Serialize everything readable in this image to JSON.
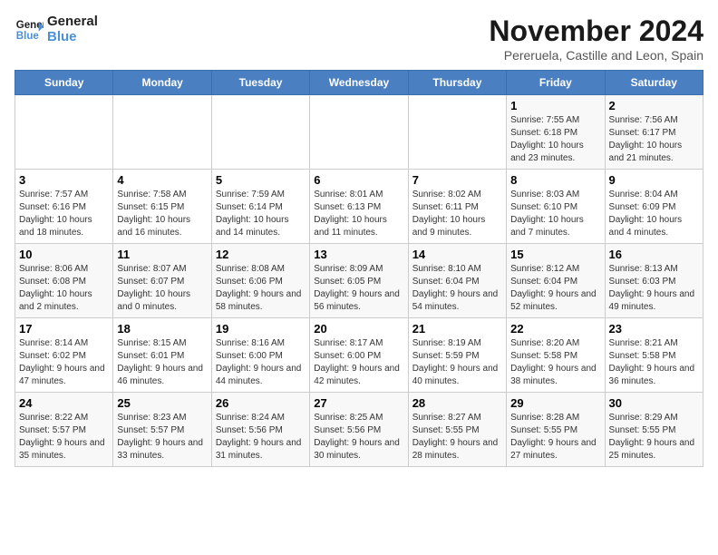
{
  "logo": {
    "line1": "General",
    "line2": "Blue"
  },
  "title": "November 2024",
  "subtitle": "Pereruela, Castille and Leon, Spain",
  "days_header": [
    "Sunday",
    "Monday",
    "Tuesday",
    "Wednesday",
    "Thursday",
    "Friday",
    "Saturday"
  ],
  "weeks": [
    [
      {
        "day": "",
        "info": ""
      },
      {
        "day": "",
        "info": ""
      },
      {
        "day": "",
        "info": ""
      },
      {
        "day": "",
        "info": ""
      },
      {
        "day": "",
        "info": ""
      },
      {
        "day": "1",
        "info": "Sunrise: 7:55 AM\nSunset: 6:18 PM\nDaylight: 10 hours and 23 minutes."
      },
      {
        "day": "2",
        "info": "Sunrise: 7:56 AM\nSunset: 6:17 PM\nDaylight: 10 hours and 21 minutes."
      }
    ],
    [
      {
        "day": "3",
        "info": "Sunrise: 7:57 AM\nSunset: 6:16 PM\nDaylight: 10 hours and 18 minutes."
      },
      {
        "day": "4",
        "info": "Sunrise: 7:58 AM\nSunset: 6:15 PM\nDaylight: 10 hours and 16 minutes."
      },
      {
        "day": "5",
        "info": "Sunrise: 7:59 AM\nSunset: 6:14 PM\nDaylight: 10 hours and 14 minutes."
      },
      {
        "day": "6",
        "info": "Sunrise: 8:01 AM\nSunset: 6:13 PM\nDaylight: 10 hours and 11 minutes."
      },
      {
        "day": "7",
        "info": "Sunrise: 8:02 AM\nSunset: 6:11 PM\nDaylight: 10 hours and 9 minutes."
      },
      {
        "day": "8",
        "info": "Sunrise: 8:03 AM\nSunset: 6:10 PM\nDaylight: 10 hours and 7 minutes."
      },
      {
        "day": "9",
        "info": "Sunrise: 8:04 AM\nSunset: 6:09 PM\nDaylight: 10 hours and 4 minutes."
      }
    ],
    [
      {
        "day": "10",
        "info": "Sunrise: 8:06 AM\nSunset: 6:08 PM\nDaylight: 10 hours and 2 minutes."
      },
      {
        "day": "11",
        "info": "Sunrise: 8:07 AM\nSunset: 6:07 PM\nDaylight: 10 hours and 0 minutes."
      },
      {
        "day": "12",
        "info": "Sunrise: 8:08 AM\nSunset: 6:06 PM\nDaylight: 9 hours and 58 minutes."
      },
      {
        "day": "13",
        "info": "Sunrise: 8:09 AM\nSunset: 6:05 PM\nDaylight: 9 hours and 56 minutes."
      },
      {
        "day": "14",
        "info": "Sunrise: 8:10 AM\nSunset: 6:04 PM\nDaylight: 9 hours and 54 minutes."
      },
      {
        "day": "15",
        "info": "Sunrise: 8:12 AM\nSunset: 6:04 PM\nDaylight: 9 hours and 52 minutes."
      },
      {
        "day": "16",
        "info": "Sunrise: 8:13 AM\nSunset: 6:03 PM\nDaylight: 9 hours and 49 minutes."
      }
    ],
    [
      {
        "day": "17",
        "info": "Sunrise: 8:14 AM\nSunset: 6:02 PM\nDaylight: 9 hours and 47 minutes."
      },
      {
        "day": "18",
        "info": "Sunrise: 8:15 AM\nSunset: 6:01 PM\nDaylight: 9 hours and 46 minutes."
      },
      {
        "day": "19",
        "info": "Sunrise: 8:16 AM\nSunset: 6:00 PM\nDaylight: 9 hours and 44 minutes."
      },
      {
        "day": "20",
        "info": "Sunrise: 8:17 AM\nSunset: 6:00 PM\nDaylight: 9 hours and 42 minutes."
      },
      {
        "day": "21",
        "info": "Sunrise: 8:19 AM\nSunset: 5:59 PM\nDaylight: 9 hours and 40 minutes."
      },
      {
        "day": "22",
        "info": "Sunrise: 8:20 AM\nSunset: 5:58 PM\nDaylight: 9 hours and 38 minutes."
      },
      {
        "day": "23",
        "info": "Sunrise: 8:21 AM\nSunset: 5:58 PM\nDaylight: 9 hours and 36 minutes."
      }
    ],
    [
      {
        "day": "24",
        "info": "Sunrise: 8:22 AM\nSunset: 5:57 PM\nDaylight: 9 hours and 35 minutes."
      },
      {
        "day": "25",
        "info": "Sunrise: 8:23 AM\nSunset: 5:57 PM\nDaylight: 9 hours and 33 minutes."
      },
      {
        "day": "26",
        "info": "Sunrise: 8:24 AM\nSunset: 5:56 PM\nDaylight: 9 hours and 31 minutes."
      },
      {
        "day": "27",
        "info": "Sunrise: 8:25 AM\nSunset: 5:56 PM\nDaylight: 9 hours and 30 minutes."
      },
      {
        "day": "28",
        "info": "Sunrise: 8:27 AM\nSunset: 5:55 PM\nDaylight: 9 hours and 28 minutes."
      },
      {
        "day": "29",
        "info": "Sunrise: 8:28 AM\nSunset: 5:55 PM\nDaylight: 9 hours and 27 minutes."
      },
      {
        "day": "30",
        "info": "Sunrise: 8:29 AM\nSunset: 5:55 PM\nDaylight: 9 hours and 25 minutes."
      }
    ]
  ]
}
